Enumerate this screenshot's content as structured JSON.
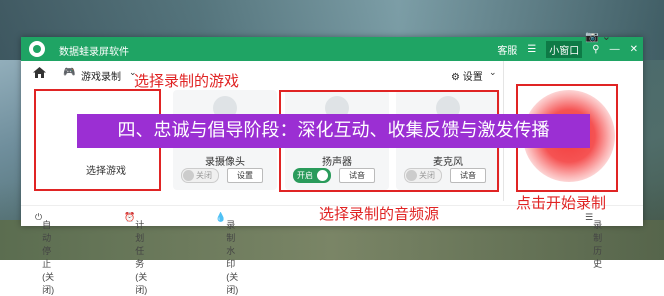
{
  "app": {
    "title": "数据蛙录屏软件",
    "service": "客服",
    "mini_window": "小窗口",
    "pin_icon": "pin-icon",
    "min_icon": "minimize-icon",
    "close_icon": "close-icon"
  },
  "toolbar": {
    "mode": "游戏录制",
    "settings": "设置"
  },
  "cards": {
    "game": {
      "label": "选择游戏"
    },
    "camera": {
      "label": "录摄像头",
      "toggle": "关闭",
      "button": "设置"
    },
    "speaker": {
      "label": "扬声器",
      "toggle": "开启",
      "button": "试音"
    },
    "mic": {
      "label": "麦克风",
      "toggle": "关闭",
      "button": "试音"
    }
  },
  "statusbar": {
    "auto_stop": "自动停止 (关闭)",
    "schedule": "计划任务 (关闭)",
    "watermark": "录制水印 (关闭)",
    "history": "录制历史"
  },
  "annotations": {
    "select_game": "选择录制的游戏",
    "select_audio": "选择录制的音频源",
    "start_record": "点击开始录制"
  },
  "banner": "四、忠诚与倡导阶段：深化互动、收集反馈与激发传播",
  "colors": {
    "titlebar": "#1fa464",
    "annotation": "#e02424",
    "banner": "#9b2fd3",
    "record": "#f23c3c"
  }
}
